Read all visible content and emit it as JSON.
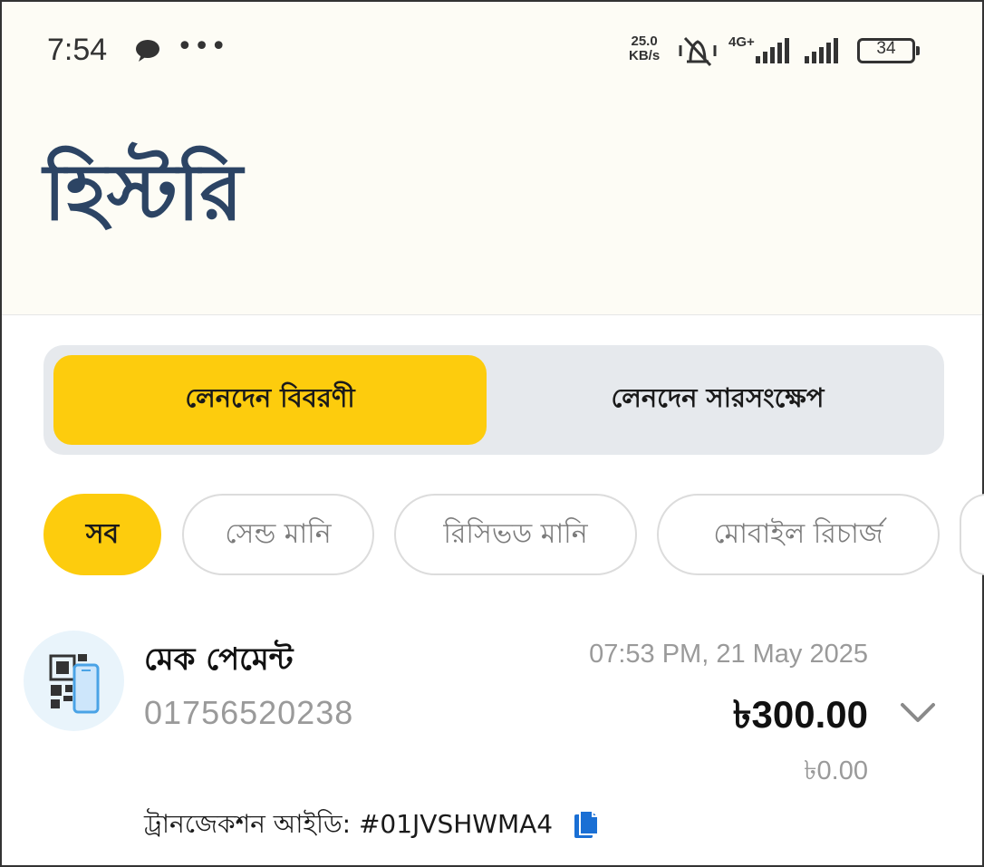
{
  "status_bar": {
    "time": "7:54",
    "net_speed_value": "25.0",
    "net_speed_unit": "KB/s",
    "network_type": "4G+",
    "battery": "34",
    "icons": [
      "chat-bubble-icon",
      "more-dots-icon",
      "vibrate-off-icon",
      "signal-icon",
      "signal-icon",
      "battery-icon"
    ]
  },
  "header": {
    "title": "হিস্টরি"
  },
  "segmented": {
    "tabs": [
      {
        "label": "লেনদেন বিবরণী",
        "active": true
      },
      {
        "label": "লেনদেন সারসংক্ষেপ",
        "active": false
      }
    ]
  },
  "filters": {
    "chips": [
      {
        "label": "সব",
        "active": true
      },
      {
        "label": "সেন্ড মানি",
        "active": false
      },
      {
        "label": "রিসিভড মানি",
        "active": false
      },
      {
        "label": "মোবাইল রিচার্জ",
        "active": false
      }
    ]
  },
  "transactions": [
    {
      "title": "মেক পেমেন্ট",
      "phone": "01756520238",
      "datetime": "07:53 PM, 21 May 2025",
      "amount": "৳300.00",
      "fee": "৳0.00",
      "txn_id": "ট্রানজেকশন আইডি: #01JVSHWMA4",
      "icon": "qr-phone-icon"
    }
  ],
  "colors": {
    "accent": "#fdcc0d",
    "title": "#2c4464",
    "header_bg": "#fdfcf5",
    "copy_icon": "#1a6fd4"
  }
}
